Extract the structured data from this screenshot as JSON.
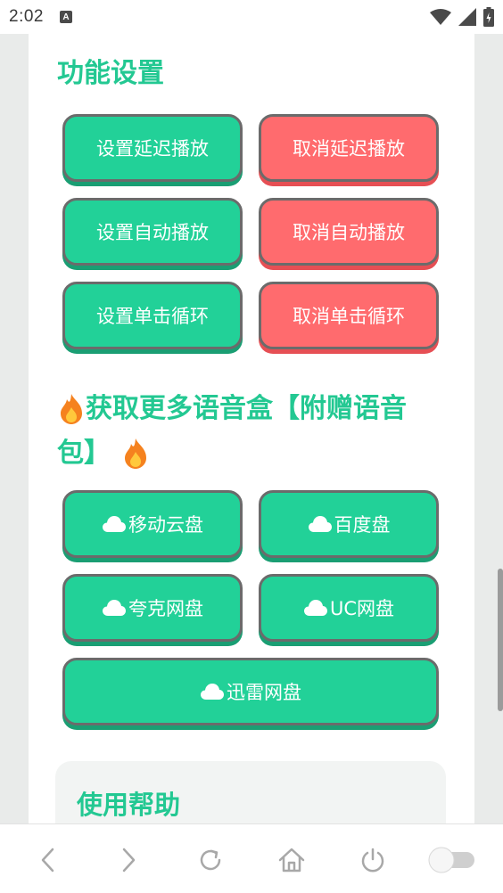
{
  "status_bar": {
    "time": "2:02",
    "notification_letter": "A"
  },
  "sections": {
    "function_settings": {
      "title": "功能设置",
      "buttons": [
        {
          "label": "设置延迟播放",
          "style": "green"
        },
        {
          "label": "取消延迟播放",
          "style": "red"
        },
        {
          "label": "设置自动播放",
          "style": "green"
        },
        {
          "label": "取消自动播放",
          "style": "red"
        },
        {
          "label": "设置单击循环",
          "style": "green"
        },
        {
          "label": "取消单击循环",
          "style": "red"
        }
      ]
    },
    "more_voice": {
      "title_line1": "获取更多语音盒【附赠语音",
      "title_line2": "包】",
      "buttons": [
        {
          "label": "移动云盘",
          "icon": "cloud-icon"
        },
        {
          "label": "百度盘",
          "icon": "cloud-icon"
        },
        {
          "label": "夸克网盘",
          "icon": "cloud-icon"
        },
        {
          "label": "UC网盘",
          "icon": "cloud-icon"
        },
        {
          "label": "迅雷网盘",
          "icon": "cloud-icon"
        }
      ]
    },
    "help": {
      "title": "使用帮助"
    }
  },
  "colors": {
    "accent_green": "#23c892",
    "button_green": "#22d198",
    "button_red": "#ff6b6e"
  },
  "bottom_nav": [
    "back-icon",
    "forward-icon",
    "reload-icon",
    "home-icon",
    "power-icon",
    "toggle-icon"
  ]
}
